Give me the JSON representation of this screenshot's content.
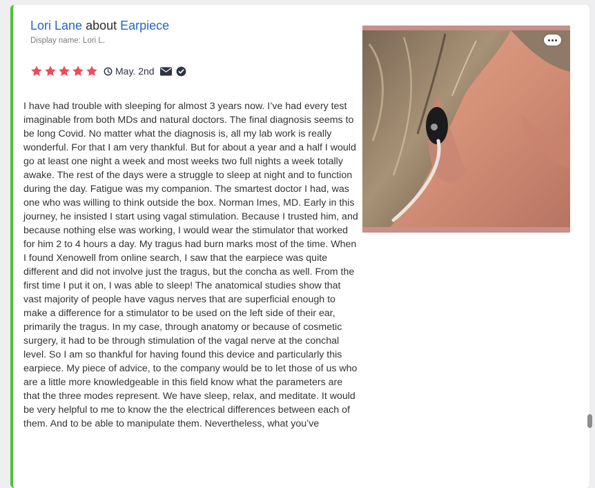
{
  "review": {
    "author": "Lori Lane",
    "connector": "about",
    "product": "Earpiece",
    "display_name": "Display name: Lori L.",
    "rating": 5,
    "rating_max": 5,
    "date": "May. 2nd",
    "icons": {
      "star": "star-icon",
      "date": "clock-icon",
      "contact": "envelope-icon",
      "verified": "check-circle-icon",
      "photo_menu": "more-icon"
    },
    "body": "I have had trouble with sleeping for almost 3 years now. I’ve had every test imaginable from both MDs and natural doctors. The final diagnosis seems to be long Covid. No matter what the diagnosis is, all my lab work is really wonderful. For that I am very thankful. But for about a year and a half I would go at least one night a week and most weeks two full nights a week totally awake. The rest of the days were a struggle to sleep at night and to function during the day. Fatigue was my companion. The smartest doctor I had, was one who was willing to think outside the box. Norman Imes, MD.  Early in this journey, he insisted I start using vagal stimulation. Because I trusted him, and because nothing else was working, I would wear the stimulator that worked for him 2 to 4 hours a day. My tragus had burn marks most of the time. When I found Xenowell from online search, I saw that the earpiece was quite different and did not involve just the tragus, but the concha as well. From the first time I put it on, I was able to sleep! The anatomical studies show that vast majority of people have vagus nerves that are superficial enough to make a difference for a stimulator to be used  on the left side of their ear, primarily  the tragus. In my case, through anatomy or because of cosmetic surgery, it had to be through stimulation of the vagal nerve at the conchal level. So I am so thankful for having found this device and particularly this earpiece. My piece of advice, to the company would be to let those of us who are a little more knowledgeable in this field know what the parameters are that the three modes represent. We have sleep, relax, and meditate. It would be very helpful to me to know the the electrical differences between each of them.  And to be able to manipulate them. Nevertheless, what you’ve"
  },
  "colors": {
    "accent_border": "#4ec237",
    "link": "#1f66c7",
    "star": "#ef4a5b",
    "icon": "#2e3340",
    "photo_frame": "#c7908a"
  }
}
